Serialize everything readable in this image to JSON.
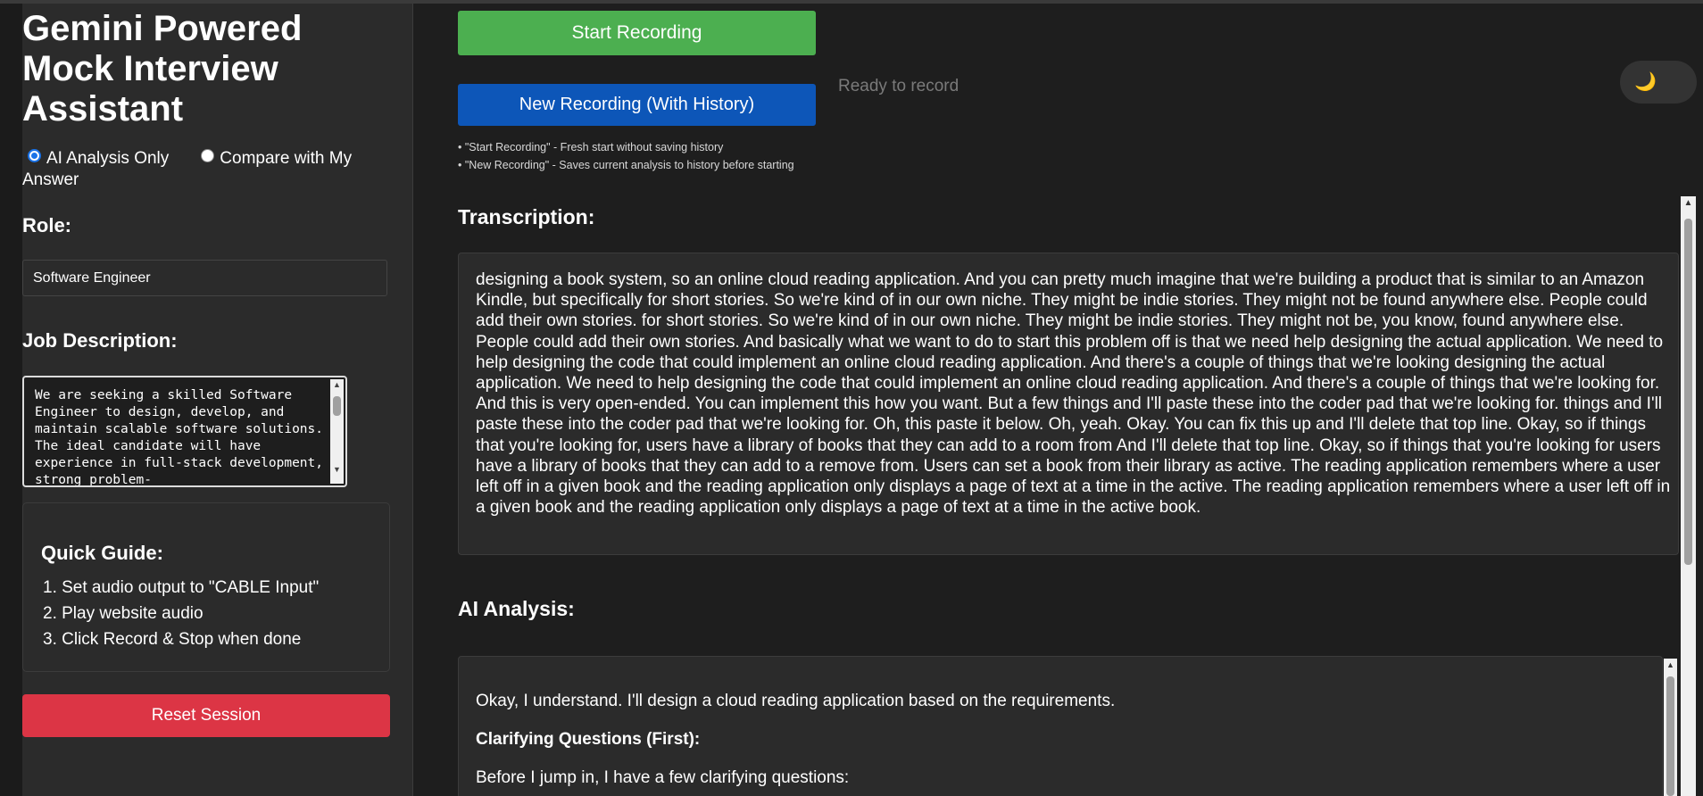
{
  "app": {
    "title": "Gemini Powered Mock Interview Assistant"
  },
  "mode": {
    "option_ai": "AI Analysis Only",
    "option_compare": "Compare with My Answer",
    "selected": "AI Analysis Only"
  },
  "role": {
    "label": "Role:",
    "value": "Software Engineer"
  },
  "job_description": {
    "label": "Job Description:",
    "value": "We are seeking a skilled Software Engineer to design, develop, and maintain scalable software solutions. The ideal candidate will have experience in full-stack development, strong problem-"
  },
  "guide": {
    "title": "Quick Guide:",
    "steps": [
      "1. Set audio output to \"CABLE Input\"",
      "2. Play website audio",
      "3. Click Record & Stop when done"
    ]
  },
  "reset_label": "Reset Session",
  "controls": {
    "start_label": "Start Recording",
    "new_label": "New Recording (With History)",
    "status": "Ready to record",
    "hint_start": "• \"Start Recording\" - Fresh start without saving history",
    "hint_new": "• \"New Recording\" - Saves current analysis to history before starting"
  },
  "theme_toggle": {
    "icon": "moon-icon",
    "glyph": "🌙"
  },
  "transcription": {
    "heading": "Transcription:",
    "text": "designing a book system, so an online cloud reading application. And you can pretty much imagine that we're building a product that is similar to an Amazon Kindle, but specifically for short stories. So we're kind of in our own niche. They might be indie stories. They might not be found anywhere else. People could add their own stories. for short stories. So we're kind of in our own niche. They might be indie stories. They might not be, you know, found anywhere else. People could add their own stories. And basically what we want to do to start this problem off is that we need help designing the actual application. We need to help designing the code that could implement an online cloud reading application. And there's a couple of things that we're looking designing the actual application. We need to help designing the code that could implement an online cloud reading application. And there's a couple of things that we're looking for. And this is very open-ended. You can implement this how you want. But a few things and I'll paste these into the coder pad that we're looking for. things and I'll paste these into the coder pad that we're looking for. Oh, this paste it below. Oh, yeah. Okay. You can fix this up and I'll delete that top line. Okay, so if things that you're looking for, users have a library of books that they can add to a room from And I'll delete that top line. Okay, so if things that you're looking for users have a library of books that they can add to a remove from. Users can set a book from their library as active. The reading application remembers where a user left off in a given book and the reading application only displays a page of text at a time in the active. The reading application remembers where a user left off in a given book and the reading application only displays a page of text at a time in the active book."
  },
  "analysis": {
    "heading": "AI Analysis:",
    "intro": "Okay, I understand. I'll design a cloud reading application based on the requirements.",
    "subheading": "Clarifying Questions (First):",
    "lead": "Before I jump in, I have a few clarifying questions:"
  },
  "colors": {
    "start_button": "#4caf50",
    "new_button": "#0d56b8",
    "reset_button": "#dc3545",
    "background": "#1e1e1e",
    "panel": "#2b2b2b"
  }
}
